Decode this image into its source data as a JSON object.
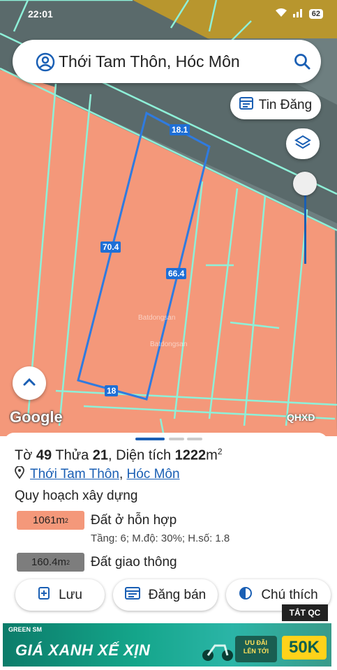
{
  "status_bar": {
    "time": "22:01",
    "battery": "62"
  },
  "search": {
    "query": "Thới Tam Thôn, Hóc Môn"
  },
  "map": {
    "tin_dang_label": "Tin Đăng",
    "measure_top": "18.1",
    "measure_left": "70.4",
    "measure_right": "66.4",
    "measure_bottom": "18",
    "google_logo": "Google",
    "map_mode": "QHXD",
    "watermark": "Batdongsan"
  },
  "sheet": {
    "title": {
      "sheet_prefix": "Tờ",
      "sheet_no": "49",
      "parcel_prefix": "Thửa",
      "parcel_no": "21",
      "area_prefix": ", Diện tích",
      "area_value": "1222",
      "area_unit": "m",
      "area_sup": "2"
    },
    "location": {
      "ward": "Thới Tam Thôn",
      "separator": ", ",
      "district": "Hóc Môn"
    },
    "section_title": "Quy hoạch xây dựng",
    "zones": [
      {
        "area": "1061",
        "unit": "m",
        "sup": "2",
        "label": "Đất ở hỗn hợp",
        "color": "#f4987a",
        "detail": "Tầng: 6; M.độ: 30%; H.số: 1.8"
      },
      {
        "area": "160.4",
        "unit": "m",
        "sup": "2",
        "label": "Đất giao thông",
        "color": "#7d7d7d"
      }
    ],
    "actions": {
      "save": "Lưu",
      "post_sale": "Đăng bán",
      "legend": "Chú thích"
    }
  },
  "ad": {
    "close_label": "TẮT QC",
    "brand": "GREEN SM",
    "headline": "GIÁ XANH XẾ XỊN",
    "deal_line1": "ƯU ĐÃI",
    "deal_line2": "LÊN TỚI",
    "amount": "50K"
  },
  "colors": {
    "accent_blue": "#1a5fb4",
    "zone_orange": "#f4987a",
    "zone_gray": "#7d7d7d",
    "boundary_cyan": "#8ef0d8",
    "parcel_blue": "#2f7be0"
  }
}
